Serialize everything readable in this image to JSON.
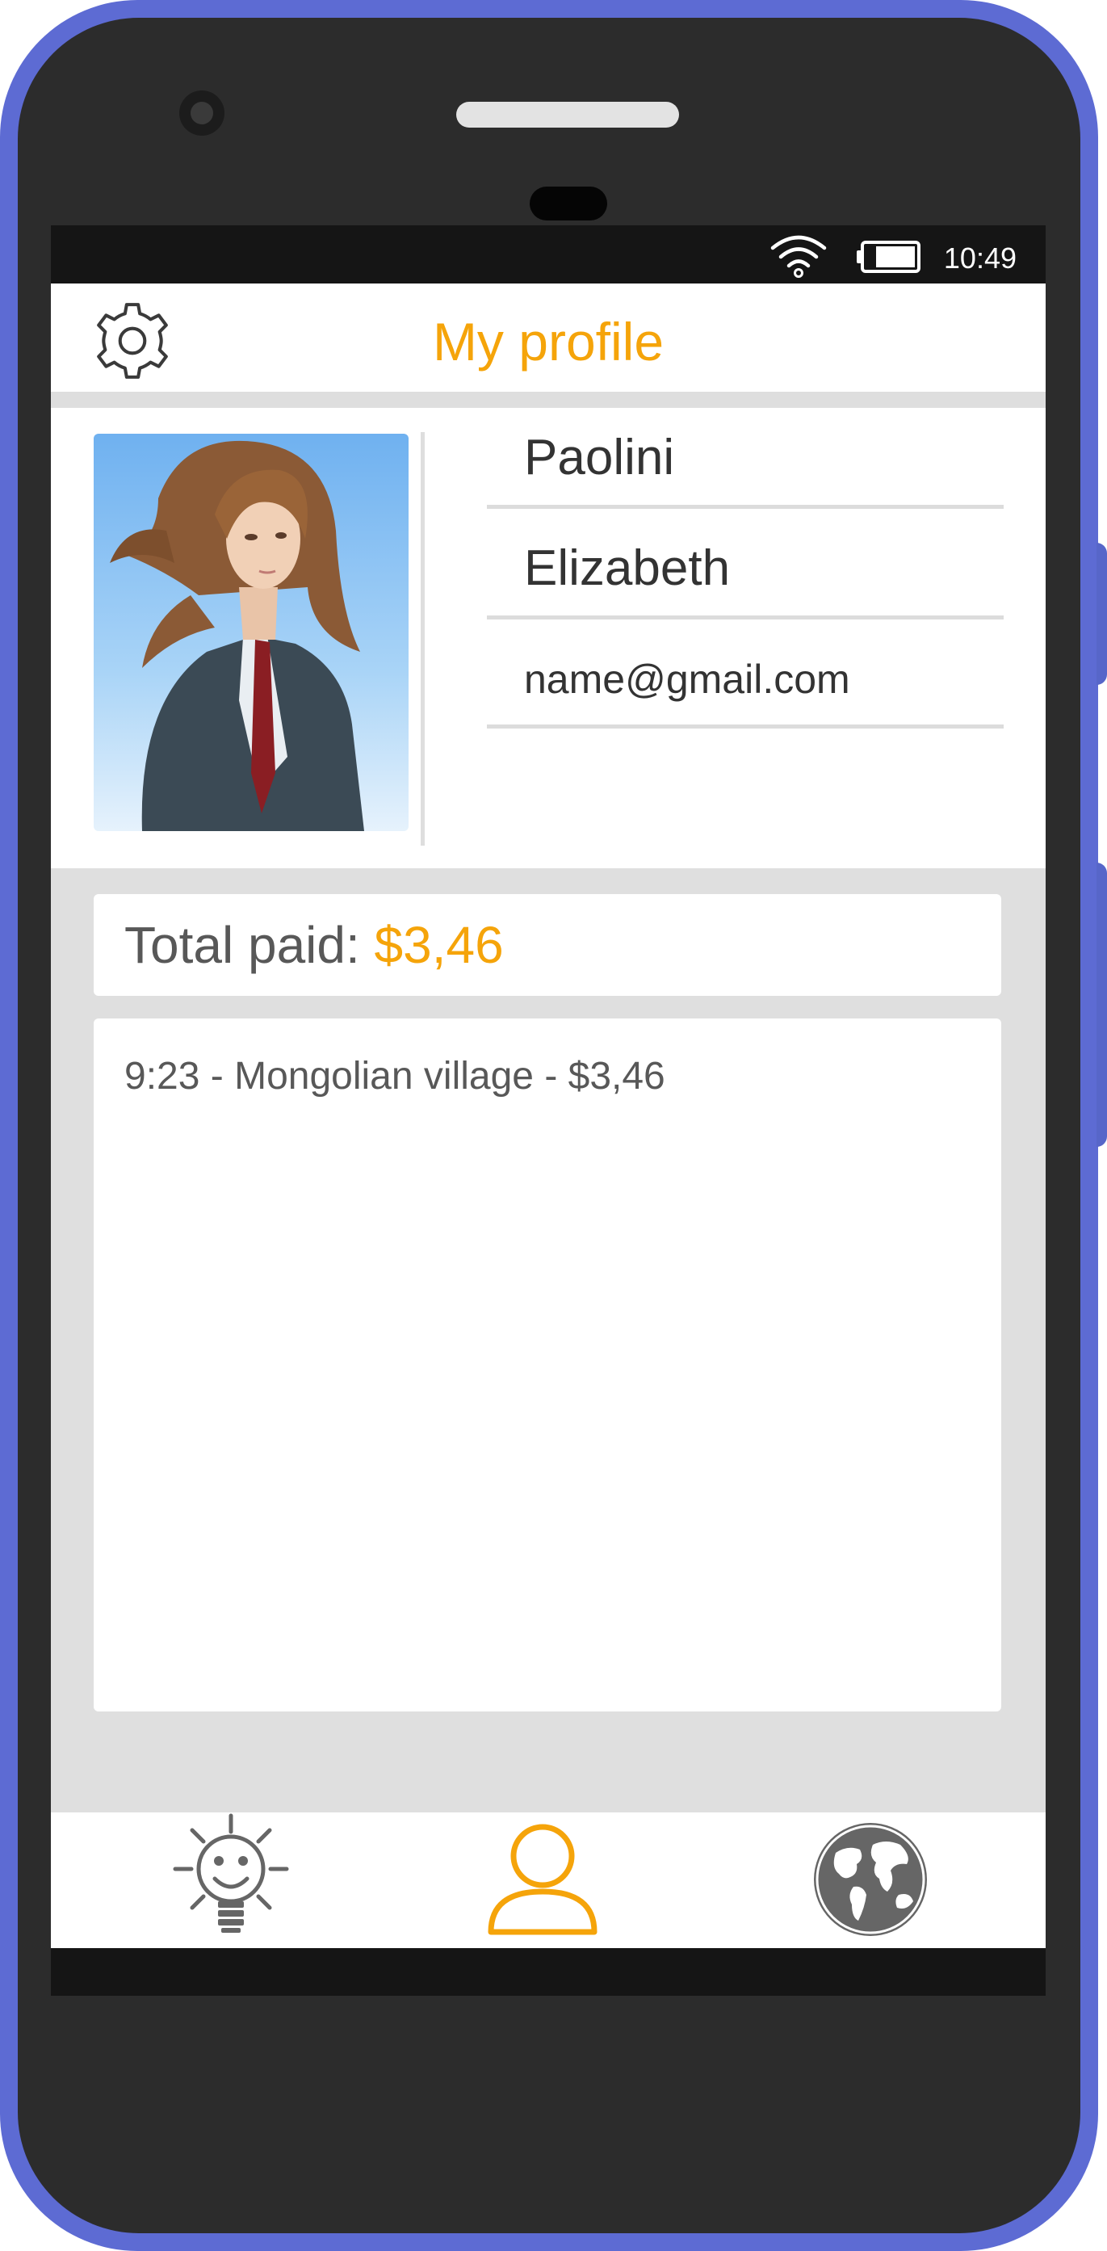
{
  "status_bar": {
    "time": "10:49",
    "wifi_icon": "wifi-icon",
    "battery_icon": "battery-icon"
  },
  "app_bar": {
    "title": "My profile",
    "settings_icon": "gear-icon"
  },
  "profile": {
    "avatar_icon": "profile-photo",
    "last_name": "Paolini",
    "first_name": "Elizabeth",
    "email": "name@gmail.com"
  },
  "payments": {
    "total_label": "Total paid: ",
    "total_value": "$3,46",
    "history": [
      "9:23 - Mongolian village - $3,46"
    ]
  },
  "bottom_nav": {
    "items": [
      {
        "icon": "lightbulb-smile-icon",
        "active": false
      },
      {
        "icon": "user-icon",
        "active": true
      },
      {
        "icon": "globe-icon",
        "active": false
      }
    ]
  },
  "colors": {
    "accent": "#f5a40a",
    "phone": "#5d6bd3",
    "bezel": "#2c2c2c",
    "icon_gray": "#666666"
  }
}
